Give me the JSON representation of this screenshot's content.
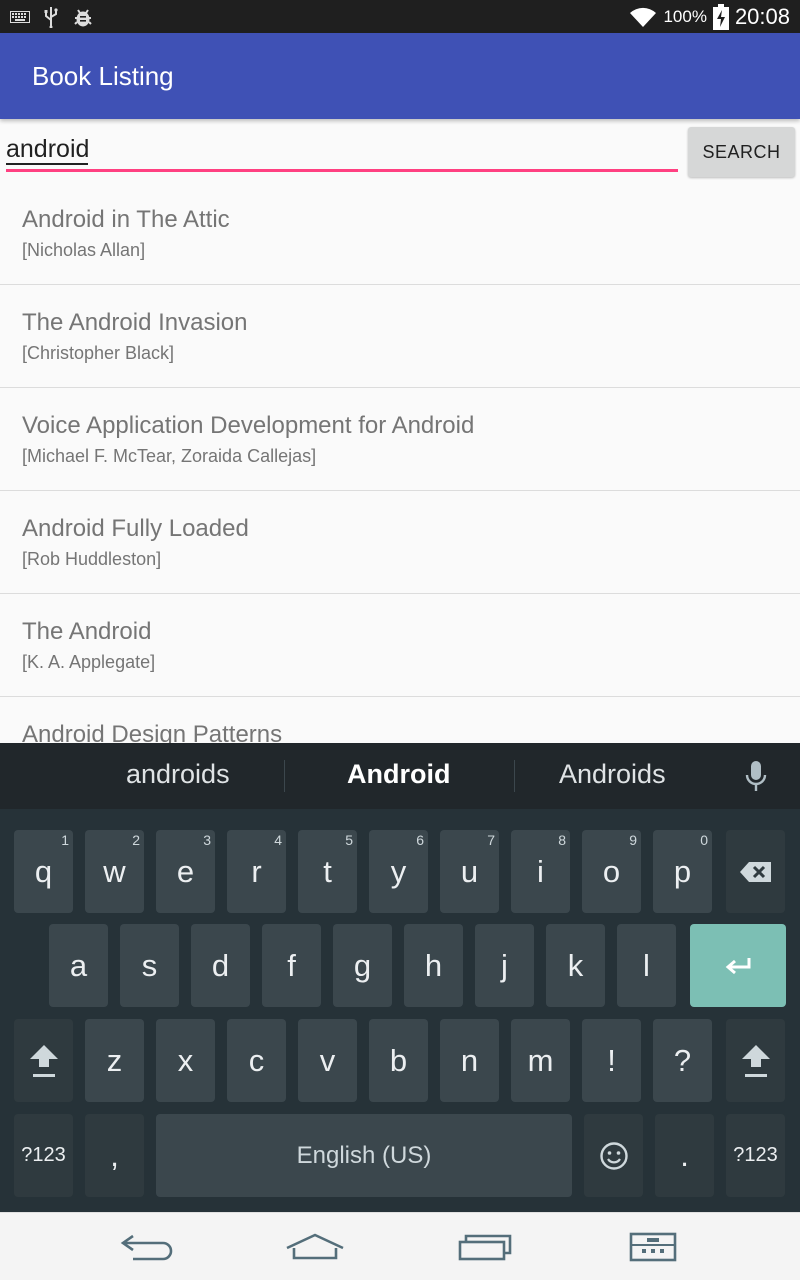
{
  "status_bar": {
    "left_icons": [
      "keyboard-icon",
      "usb-icon",
      "debug-bug-icon"
    ],
    "battery_text": "100%",
    "time": "20:08"
  },
  "app_bar": {
    "title": "Book Listing"
  },
  "search": {
    "value": "android",
    "button_label": "SEARCH"
  },
  "books": [
    {
      "title": "Android in The Attic",
      "authors": "[Nicholas Allan]"
    },
    {
      "title": "The Android Invasion",
      "authors": "[Christopher Black]"
    },
    {
      "title": "Voice Application Development for Android",
      "authors": "[Michael F. McTear, Zoraida Callejas]"
    },
    {
      "title": "Android Fully Loaded",
      "authors": "[Rob Huddleston]"
    },
    {
      "title": "The Android",
      "authors": "[K. A. Applegate]"
    },
    {
      "title": "Android Design Patterns",
      "authors": ""
    }
  ],
  "keyboard": {
    "suggestions": [
      "androids",
      "Android",
      "Androids"
    ],
    "row1": [
      {
        "key": "q",
        "hint": "1"
      },
      {
        "key": "w",
        "hint": "2"
      },
      {
        "key": "e",
        "hint": "3"
      },
      {
        "key": "r",
        "hint": "4"
      },
      {
        "key": "t",
        "hint": "5"
      },
      {
        "key": "y",
        "hint": "6"
      },
      {
        "key": "u",
        "hint": "7"
      },
      {
        "key": "i",
        "hint": "8"
      },
      {
        "key": "o",
        "hint": "9"
      },
      {
        "key": "p",
        "hint": "0"
      }
    ],
    "row2": [
      "a",
      "s",
      "d",
      "f",
      "g",
      "h",
      "j",
      "k",
      "l"
    ],
    "row3": [
      "z",
      "x",
      "c",
      "v",
      "b",
      "n",
      "m",
      "!",
      "?"
    ],
    "row4": {
      "symbols_left": "?123",
      "comma": ",",
      "space": "English (US)",
      "period": ".",
      "symbols_right": "?123"
    },
    "accent_color": "#7cbfb4"
  },
  "colors": {
    "primary": "#3f51b5",
    "accent": "#ff4081"
  }
}
